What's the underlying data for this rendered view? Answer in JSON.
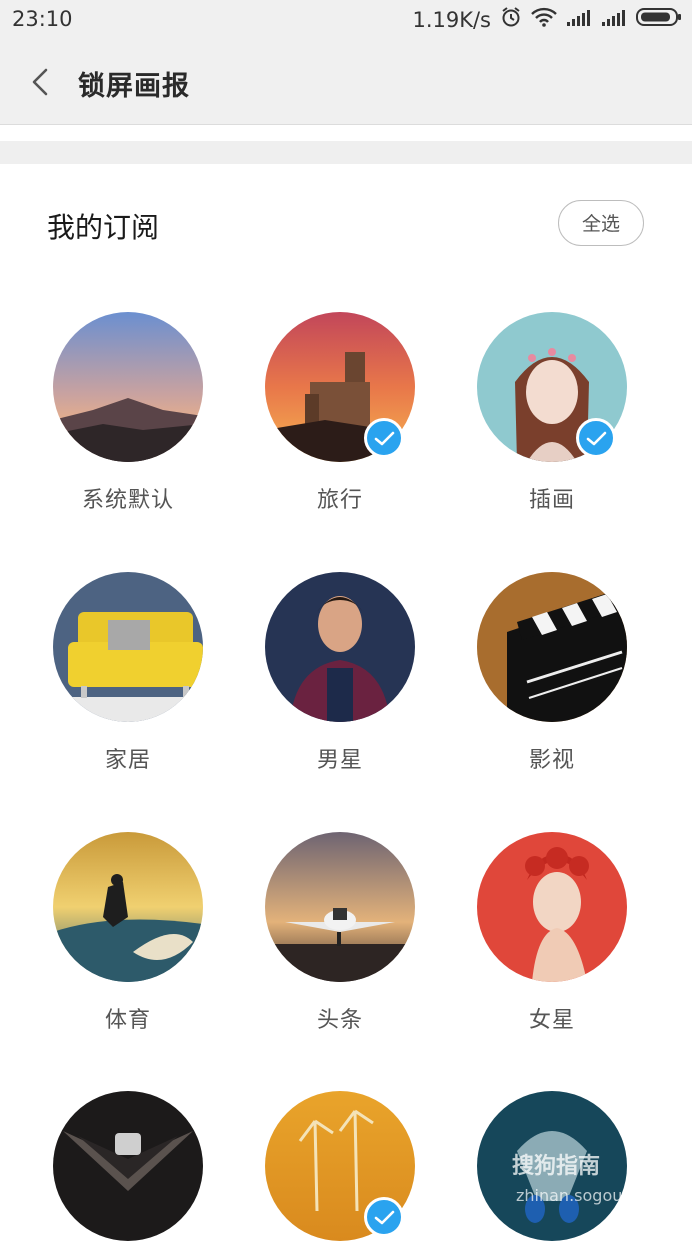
{
  "status_bar": {
    "time": "23:10",
    "speed": "1.19K/s",
    "icons": [
      "alarm-icon",
      "wifi-icon",
      "signal-icon",
      "signal-icon",
      "battery-icon"
    ]
  },
  "header": {
    "title": "锁屏画报",
    "back_icon": "chevron-left-icon"
  },
  "subscription": {
    "title": "我的订阅",
    "select_all": "全选",
    "accent_color": "#2aa3ef",
    "categories": [
      {
        "label": "系统默认",
        "checked": false
      },
      {
        "label": "旅行",
        "checked": true
      },
      {
        "label": "插画",
        "checked": true
      },
      {
        "label": "家居",
        "checked": false
      },
      {
        "label": "男星",
        "checked": false
      },
      {
        "label": "影视",
        "checked": false
      },
      {
        "label": "体育",
        "checked": false
      },
      {
        "label": "头条",
        "checked": false
      },
      {
        "label": "女星",
        "checked": false
      },
      {
        "label": "",
        "checked": false
      },
      {
        "label": "",
        "checked": true
      },
      {
        "label": "",
        "checked": false
      }
    ]
  },
  "watermark": {
    "brand": "搜狗指南",
    "url": "zhinan.sogou.com"
  }
}
